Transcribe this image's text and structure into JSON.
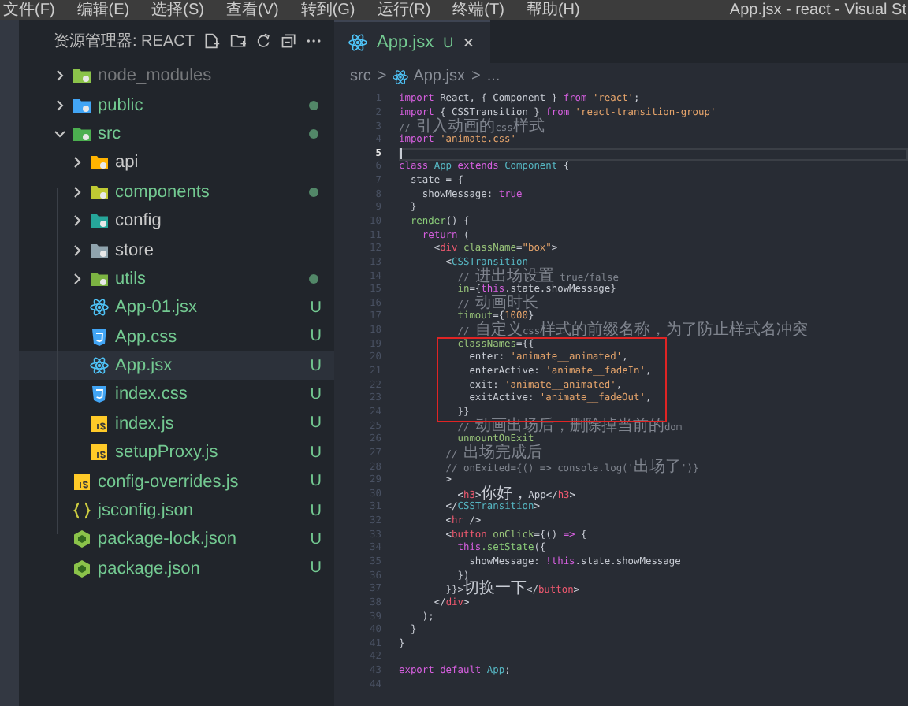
{
  "menu": [
    "文件(F)",
    "编辑(E)",
    "选择(S)",
    "查看(V)",
    "转到(G)",
    "运行(R)",
    "终端(T)",
    "帮助(H)"
  ],
  "window": {
    "title": "App.jsx - react - Visual St"
  },
  "explorer": {
    "title": "资源管理器: REACT",
    "items": [
      {
        "name": "node_modules",
        "kind": "folder",
        "color": "#8bc34a",
        "ignored": true,
        "untracked": false,
        "dot": false,
        "selected": false,
        "expanded": false
      },
      {
        "name": "public",
        "kind": "folder",
        "color": "#42a5f5",
        "ignored": false,
        "untracked": true,
        "dot": true,
        "selected": false,
        "expanded": false
      },
      {
        "name": "src",
        "kind": "folder",
        "color": "#4caf50",
        "ignored": false,
        "untracked": true,
        "dot": true,
        "selected": false,
        "expanded": true,
        "children": [
          {
            "name": "api",
            "kind": "folder",
            "color": "#ffb300",
            "ignored": false,
            "untracked": false,
            "dot": false,
            "selected": false,
            "expanded": false
          },
          {
            "name": "components",
            "kind": "folder",
            "color": "#c0ca33",
            "ignored": false,
            "untracked": true,
            "dot": true,
            "selected": false,
            "expanded": false
          },
          {
            "name": "config",
            "kind": "folder",
            "color": "#26a69a",
            "ignored": false,
            "untracked": false,
            "dot": false,
            "selected": false,
            "expanded": false
          },
          {
            "name": "store",
            "kind": "folder",
            "color": "#90a4ae",
            "ignored": false,
            "untracked": false,
            "dot": false,
            "selected": false,
            "expanded": false
          },
          {
            "name": "utils",
            "kind": "folder",
            "color": "#7cb342",
            "ignored": false,
            "untracked": true,
            "dot": true,
            "selected": false,
            "expanded": false
          },
          {
            "name": "App-01.jsx",
            "kind": "react",
            "ignored": false,
            "untracked": true,
            "dot": false,
            "badge": "U",
            "selected": false
          },
          {
            "name": "App.css",
            "kind": "css",
            "ignored": false,
            "untracked": true,
            "dot": false,
            "badge": "U",
            "selected": false
          },
          {
            "name": "App.jsx",
            "kind": "react",
            "ignored": false,
            "untracked": true,
            "dot": false,
            "badge": "U",
            "selected": true
          },
          {
            "name": "index.css",
            "kind": "css",
            "ignored": false,
            "untracked": true,
            "dot": false,
            "badge": "U",
            "selected": false
          },
          {
            "name": "index.js",
            "kind": "js",
            "ignored": false,
            "untracked": true,
            "dot": false,
            "badge": "U",
            "selected": false
          },
          {
            "name": "setupProxy.js",
            "kind": "js",
            "ignored": false,
            "untracked": true,
            "dot": false,
            "badge": "U",
            "selected": false
          }
        ]
      },
      {
        "name": "config-overrides.js",
        "kind": "js",
        "ignored": false,
        "untracked": true,
        "dot": false,
        "badge": "U",
        "selected": false
      },
      {
        "name": "jsconfig.json",
        "kind": "json",
        "ignored": false,
        "untracked": true,
        "dot": false,
        "badge": "U",
        "selected": false
      },
      {
        "name": "package-lock.json",
        "kind": "node",
        "ignored": false,
        "untracked": true,
        "dot": false,
        "badge": "U",
        "selected": false
      },
      {
        "name": "package.json",
        "kind": "node",
        "ignored": false,
        "untracked": true,
        "dot": false,
        "badge": "U",
        "selected": false
      }
    ]
  },
  "tabs": [
    {
      "label": "App.jsx",
      "badge": "U",
      "close": "×",
      "selected": true
    }
  ],
  "breadcrumbs": [
    {
      "kind": "crumb",
      "label": "src"
    },
    {
      "kind": "sep",
      "label": ">"
    },
    {
      "kind": "file",
      "label": "App.jsx"
    },
    {
      "kind": "sep",
      "label": ">"
    },
    {
      "kind": "crumb",
      "label": "..."
    }
  ],
  "code": [
    {
      "number": "1",
      "current": false,
      "boxed": false,
      "tokens": [
        {
          "kind": "kw",
          "text": "import "
        },
        {
          "kind": "pl",
          "text": "React, { Component } "
        },
        {
          "kind": "kw",
          "text": "from "
        },
        {
          "kind": "str",
          "text": "'react'"
        },
        {
          "kind": "pl",
          "text": ";"
        }
      ]
    },
    {
      "number": "2",
      "current": false,
      "boxed": false,
      "tokens": [
        {
          "kind": "kw",
          "text": "import "
        },
        {
          "kind": "pl",
          "text": "{ CSSTransition } "
        },
        {
          "kind": "kw",
          "text": "from "
        },
        {
          "kind": "str",
          "text": "'react-transition-group'"
        }
      ]
    },
    {
      "number": "3",
      "current": false,
      "boxed": false,
      "tokens": [
        {
          "kind": "cm",
          "text": "// 引入动画的css样式"
        }
      ]
    },
    {
      "number": "4",
      "current": false,
      "boxed": false,
      "tokens": [
        {
          "kind": "kw",
          "text": "import "
        },
        {
          "kind": "str",
          "text": "'animate.css'"
        }
      ]
    },
    {
      "number": "5",
      "current": true,
      "boxed": false
    },
    {
      "number": "6",
      "current": false,
      "boxed": false,
      "tokens": [
        {
          "kind": "kw",
          "text": "class "
        },
        {
          "kind": "cls",
          "text": "App "
        },
        {
          "kind": "kw",
          "text": "extends "
        },
        {
          "kind": "cls",
          "text": "Component"
        },
        {
          "kind": "pl",
          "text": " {"
        }
      ]
    },
    {
      "number": "7",
      "current": false,
      "boxed": false,
      "tokens": [
        {
          "kind": "pl",
          "text": "  state = {"
        }
      ]
    },
    {
      "number": "8",
      "current": false,
      "boxed": false,
      "tokens": [
        {
          "kind": "pl",
          "text": "    showMessage: "
        },
        {
          "kind": "kw",
          "text": "true"
        }
      ]
    },
    {
      "number": "9",
      "current": false,
      "boxed": false,
      "tokens": [
        {
          "kind": "pl",
          "text": "  }"
        }
      ]
    },
    {
      "number": "10",
      "current": false,
      "boxed": false,
      "tokens": [
        {
          "kind": "fn",
          "text": "  render"
        },
        {
          "kind": "pl",
          "text": "() {"
        }
      ]
    },
    {
      "number": "11",
      "current": false,
      "boxed": false,
      "tokens": [
        {
          "kind": "kw",
          "text": "    return"
        },
        {
          "kind": "pl",
          "text": " ("
        }
      ]
    },
    {
      "number": "12",
      "current": false,
      "boxed": false,
      "tokens": [
        {
          "kind": "pl",
          "text": "      <"
        },
        {
          "kind": "tag",
          "text": "div "
        },
        {
          "kind": "attr",
          "text": "className"
        },
        {
          "kind": "pl",
          "text": "="
        },
        {
          "kind": "str",
          "text": "\"box\""
        },
        {
          "kind": "pl",
          "text": ">"
        }
      ]
    },
    {
      "number": "13",
      "current": false,
      "boxed": false,
      "tokens": [
        {
          "kind": "pl",
          "text": "        <"
        },
        {
          "kind": "cls",
          "text": "CSSTransition"
        }
      ]
    },
    {
      "number": "14",
      "current": false,
      "boxed": false,
      "tokens": [
        {
          "kind": "cm",
          "text": "          // 进出场设置 true/false"
        }
      ]
    },
    {
      "number": "15",
      "current": false,
      "boxed": false,
      "tokens": [
        {
          "kind": "attr",
          "text": "          in"
        },
        {
          "kind": "pl",
          "text": "={"
        },
        {
          "kind": "kw",
          "text": "this"
        },
        {
          "kind": "pl",
          "text": ".state.showMessage}"
        }
      ]
    },
    {
      "number": "16",
      "current": false,
      "boxed": false,
      "tokens": [
        {
          "kind": "cm",
          "text": "          // 动画时长"
        }
      ]
    },
    {
      "number": "17",
      "current": false,
      "boxed": false,
      "tokens": [
        {
          "kind": "attr",
          "text": "          timout"
        },
        {
          "kind": "pl",
          "text": "={"
        },
        {
          "kind": "num",
          "text": "1000"
        },
        {
          "kind": "pl",
          "text": "}"
        }
      ]
    },
    {
      "number": "18",
      "current": false,
      "boxed": false,
      "tokens": [
        {
          "kind": "cm",
          "text": "          // 自定义css样式的前缀名称，为了防止样式名冲突"
        }
      ]
    },
    {
      "number": "19",
      "current": false,
      "boxed": true,
      "tokens": [
        {
          "kind": "attr",
          "text": "          classNames"
        },
        {
          "kind": "pl",
          "text": "={{"
        }
      ]
    },
    {
      "number": "20",
      "current": false,
      "boxed": true,
      "tokens": [
        {
          "kind": "pl",
          "text": "            enter: "
        },
        {
          "kind": "str",
          "text": "'animate__animated'"
        },
        {
          "kind": "pl",
          "text": ","
        }
      ]
    },
    {
      "number": "21",
      "current": false,
      "boxed": true,
      "tokens": [
        {
          "kind": "pl",
          "text": "            enterActive: "
        },
        {
          "kind": "str",
          "text": "'animate__fadeIn'"
        },
        {
          "kind": "pl",
          "text": ","
        }
      ]
    },
    {
      "number": "22",
      "current": false,
      "boxed": true,
      "tokens": [
        {
          "kind": "pl",
          "text": "            exit: "
        },
        {
          "kind": "str",
          "text": "'animate__animated'"
        },
        {
          "kind": "pl",
          "text": ","
        }
      ]
    },
    {
      "number": "23",
      "current": false,
      "boxed": true,
      "tokens": [
        {
          "kind": "pl",
          "text": "            exitActive: "
        },
        {
          "kind": "str",
          "text": "'animate__fadeOut'"
        },
        {
          "kind": "pl",
          "text": ","
        }
      ]
    },
    {
      "number": "24",
      "current": false,
      "boxed": true,
      "tokens": [
        {
          "kind": "pl",
          "text": "          }}"
        }
      ]
    },
    {
      "number": "25",
      "current": false,
      "boxed": false,
      "tokens": [
        {
          "kind": "cm",
          "text": "          // 动画出场后，删除掉当前的dom"
        }
      ]
    },
    {
      "number": "26",
      "current": false,
      "boxed": false,
      "tokens": [
        {
          "kind": "attr",
          "text": "          unmountOnExit"
        }
      ]
    },
    {
      "number": "27",
      "current": false,
      "boxed": false,
      "tokens": [
        {
          "kind": "cm",
          "text": "        // 出场完成后"
        }
      ]
    },
    {
      "number": "28",
      "current": false,
      "boxed": false,
      "tokens": [
        {
          "kind": "cm",
          "text": "        // onExited={() => console.log('出场了')}"
        }
      ]
    },
    {
      "number": "29",
      "current": false,
      "boxed": false,
      "tokens": [
        {
          "kind": "pl",
          "text": "        >"
        }
      ]
    },
    {
      "number": "30",
      "current": false,
      "boxed": false,
      "tokens": [
        {
          "kind": "pl",
          "text": "          <"
        },
        {
          "kind": "tag",
          "text": "h3"
        },
        {
          "kind": "pl",
          "text": ">你好，App</"
        },
        {
          "kind": "tag",
          "text": "h3"
        },
        {
          "kind": "pl",
          "text": ">"
        }
      ]
    },
    {
      "number": "31",
      "current": false,
      "boxed": false,
      "tokens": [
        {
          "kind": "pl",
          "text": "        </"
        },
        {
          "kind": "cls",
          "text": "CSSTransition"
        },
        {
          "kind": "pl",
          "text": ">"
        }
      ]
    },
    {
      "number": "32",
      "current": false,
      "boxed": false,
      "tokens": [
        {
          "kind": "pl",
          "text": "        <"
        },
        {
          "kind": "tag",
          "text": "hr"
        },
        {
          "kind": "pl",
          "text": " />"
        }
      ]
    },
    {
      "number": "33",
      "current": false,
      "boxed": false,
      "tokens": [
        {
          "kind": "pl",
          "text": "        <"
        },
        {
          "kind": "tag",
          "text": "button "
        },
        {
          "kind": "attr",
          "text": "onClick"
        },
        {
          "kind": "pl",
          "text": "={() "
        },
        {
          "kind": "kw",
          "text": "=>"
        },
        {
          "kind": "pl",
          "text": " {"
        }
      ]
    },
    {
      "number": "34",
      "current": false,
      "boxed": false,
      "tokens": [
        {
          "kind": "kw",
          "text": "          this"
        },
        {
          "kind": "fn",
          "text": ".setState"
        },
        {
          "kind": "pl",
          "text": "({"
        }
      ]
    },
    {
      "number": "35",
      "current": false,
      "boxed": false,
      "tokens": [
        {
          "kind": "pl",
          "text": "            showMessage: "
        },
        {
          "kind": "kw",
          "text": "!this"
        },
        {
          "kind": "pl",
          "text": ".state.showMessage"
        }
      ]
    },
    {
      "number": "36",
      "current": false,
      "boxed": false,
      "tokens": [
        {
          "kind": "pl",
          "text": "          })"
        }
      ]
    },
    {
      "number": "37",
      "current": false,
      "boxed": false,
      "tokens": [
        {
          "kind": "pl",
          "text": "        }}>切换一下</"
        },
        {
          "kind": "tag",
          "text": "button"
        },
        {
          "kind": "pl",
          "text": ">"
        }
      ]
    },
    {
      "number": "38",
      "current": false,
      "boxed": false,
      "tokens": [
        {
          "kind": "pl",
          "text": "      </"
        },
        {
          "kind": "tag",
          "text": "div"
        },
        {
          "kind": "pl",
          "text": ">"
        }
      ]
    },
    {
      "number": "39",
      "current": false,
      "boxed": false,
      "tokens": [
        {
          "kind": "pl",
          "text": "    );"
        }
      ]
    },
    {
      "number": "40",
      "current": false,
      "boxed": false,
      "tokens": [
        {
          "kind": "pl",
          "text": "  }"
        }
      ]
    },
    {
      "number": "41",
      "current": false,
      "boxed": false,
      "tokens": [
        {
          "kind": "pl",
          "text": "}"
        }
      ]
    },
    {
      "number": "42",
      "current": false,
      "boxed": false
    },
    {
      "number": "43",
      "current": false,
      "boxed": false,
      "tokens": [
        {
          "kind": "kw",
          "text": "export default "
        },
        {
          "kind": "cls",
          "text": "App"
        },
        {
          "kind": "pl",
          "text": ";"
        }
      ]
    },
    {
      "number": "44",
      "current": false,
      "boxed": false
    }
  ]
}
